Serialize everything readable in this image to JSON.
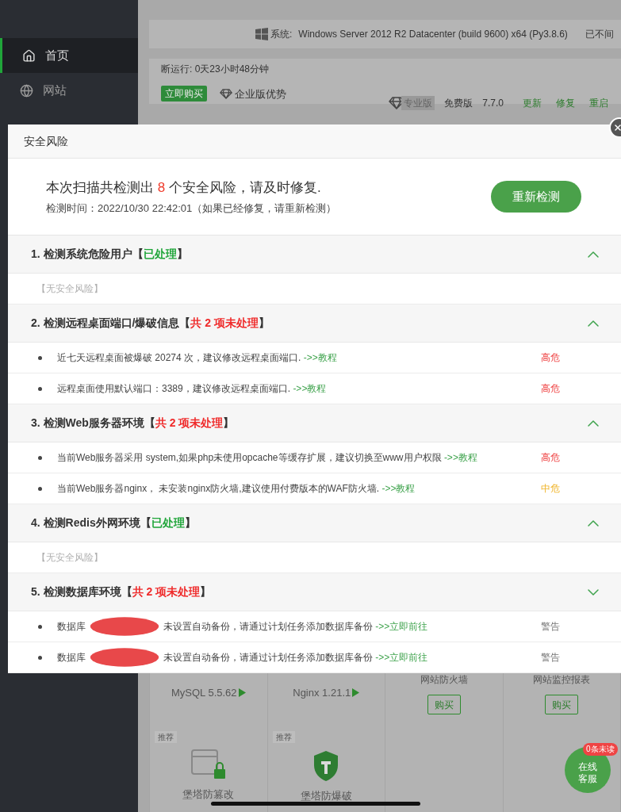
{
  "sidebar": {
    "items": [
      {
        "label": "首页",
        "selected": true
      },
      {
        "label": "网站",
        "selected": false
      }
    ]
  },
  "system": {
    "label": "系统:",
    "value": "Windows Server 2012 R2 Datacenter (build 9600) x64 (Py3.8.6)",
    "status": "已不间"
  },
  "uptime": "断运行: 0天23小时48分钟",
  "buy_button": "立即购买",
  "enterprise_link": "企业版优势",
  "version_bar": {
    "badge": "专业版",
    "edition": "免费版",
    "version": "7.7.0",
    "actions": [
      "更新",
      "修复",
      "重启"
    ]
  },
  "dialog": {
    "title": "安全风险",
    "summary_prefix": "本次扫描共检测出",
    "count": "8",
    "summary_suffix": "个安全风险，请及时修复.",
    "scan_time": "检测时间：2022/10/30 22:42:01（如果已经修复，请重新检测）",
    "rescan_button": "重新检测",
    "sections": [
      {
        "title": "1. 检测系统危险用户",
        "status": {
          "kind": "resolved",
          "open": "【",
          "label": "已处理",
          "close": "】"
        },
        "expanded": true,
        "note": "【无安全风险】"
      },
      {
        "title": "2. 检测远程桌面端口/爆破信息",
        "status": {
          "kind": "pending",
          "open": "【",
          "label": "共 2 项未处理",
          "close": "】"
        },
        "expanded": true,
        "items": [
          {
            "text": "近七天远程桌面被爆破 20274 次，建议修改远程桌面端口.",
            "link": "->>教程",
            "risk": {
              "kind": "high",
              "label": "高危"
            }
          },
          {
            "text": "远程桌面使用默认端口：3389，建议修改远程桌面端口.",
            "link": "->>教程",
            "risk": {
              "kind": "high",
              "label": "高危"
            }
          }
        ]
      },
      {
        "title": "3. 检测Web服务器环境",
        "status": {
          "kind": "pending",
          "open": "【",
          "label": "共 2 项未处理",
          "close": "】"
        },
        "expanded": true,
        "items": [
          {
            "text": "当前Web服务器采用 system,如果php未使用opcache等缓存扩展，建议切换至www用户权限",
            "link": "->>教程",
            "risk": {
              "kind": "high",
              "label": "高危"
            }
          },
          {
            "text": "当前Web服务器nginx， 未安装nginx防火墙,建议使用付费版本的WAF防火墙.",
            "link": "->>教程",
            "risk": {
              "kind": "medium",
              "label": "中危"
            }
          }
        ]
      },
      {
        "title": "4. 检测Redis外网环境",
        "status": {
          "kind": "resolved",
          "open": "【",
          "label": "已处理",
          "close": "】"
        },
        "expanded": true,
        "note": "【无安全风险】"
      },
      {
        "title": "5. 检测数据库环境",
        "status": {
          "kind": "pending",
          "open": "【",
          "label": "共 2 项未处理",
          "close": "】"
        },
        "expanded": false,
        "items": [
          {
            "text": "数据库",
            "redacted": true,
            "text_after": "未设置自动备份，请通过计划任务添加数据库备份",
            "link": "->>立即前往",
            "risk": {
              "kind": "warning",
              "label": "警告"
            }
          },
          {
            "text": "数据库",
            "redacted": true,
            "text_after": "未设置自动备份，请通过计划任务添加数据库备份",
            "link": "->>立即前往",
            "risk": {
              "kind": "warning",
              "label": "警告"
            }
          }
        ]
      }
    ]
  },
  "apps": [
    {
      "kind": "software",
      "label": "MySQL 5.5.62"
    },
    {
      "kind": "software",
      "label": "Nginx 1.21.1"
    },
    {
      "kind": "purchase",
      "label": "网站防火墙",
      "button": "购买"
    },
    {
      "kind": "purchase",
      "label": "网站监控报表",
      "button": "购买"
    },
    {
      "kind": "plugin",
      "tag": "推荐",
      "label": "堡塔防篡改"
    },
    {
      "kind": "plugin",
      "tag": "推荐",
      "label": "堡塔防爆破"
    },
    {
      "kind": "empty"
    },
    {
      "kind": "empty"
    }
  ],
  "chat": {
    "line1": "在线",
    "line2": "客服",
    "badge": "0条未读"
  }
}
